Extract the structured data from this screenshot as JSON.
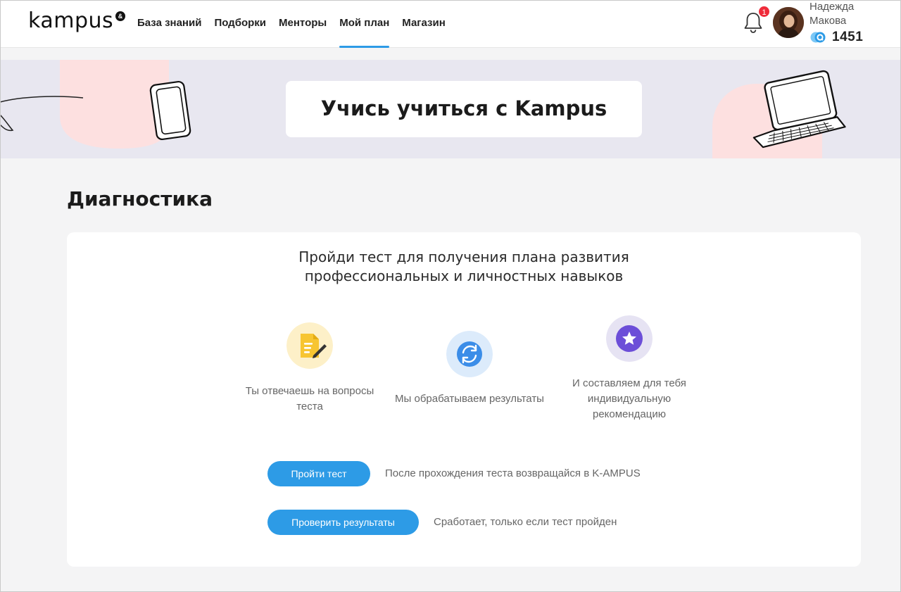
{
  "header": {
    "logo": "kampus",
    "logo_badge": "&",
    "nav": [
      {
        "label": "База знаний"
      },
      {
        "label": "Подборки"
      },
      {
        "label": "Менторы"
      },
      {
        "label": "Мой план",
        "active": true
      },
      {
        "label": "Магазин"
      }
    ],
    "notifications_count": "1",
    "user": {
      "first_name": "Надежда",
      "last_name": "Макова",
      "points": "1451"
    }
  },
  "banner": {
    "title": "Учись учиться с Kampus"
  },
  "section": {
    "title": "Диагностика"
  },
  "card": {
    "heading_line1": "Пройди тест для получения плана развития",
    "heading_line2": "профессиональных и личностных навыков",
    "steps": [
      {
        "icon": "document-pen-icon",
        "line1": "Ты отвечаешь на вопросы",
        "line2": "теста"
      },
      {
        "icon": "refresh-icon",
        "line1": "Мы обрабатываем результаты"
      },
      {
        "icon": "star-icon",
        "line1": "И составляем для тебя",
        "line2": "индивидуальную",
        "line3": "рекомендацию"
      }
    ],
    "actions": [
      {
        "label": "Пройти тест",
        "hint": "После прохождения теста возвращайся в K-AMPUS"
      },
      {
        "label": "Проверить результаты",
        "hint": "Сработает, только если тест пройден"
      }
    ]
  },
  "colors": {
    "accent": "#2d9be6",
    "badge": "#ef2b3a",
    "banner_bg": "#e8e7f0",
    "blob": "#fde0e0"
  }
}
